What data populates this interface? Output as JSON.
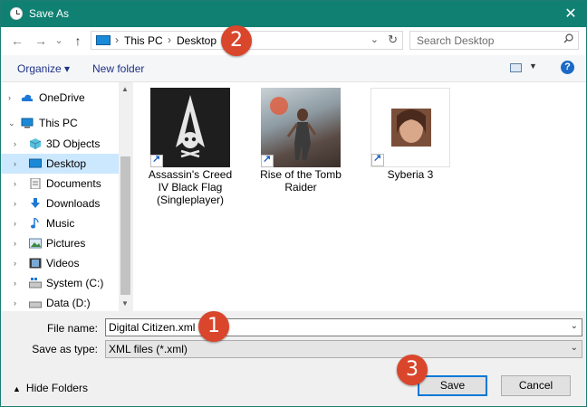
{
  "window": {
    "title": "Save As",
    "close_glyph": "✕",
    "accent_color": "#108072"
  },
  "nav": {
    "back_glyph": "←",
    "forward_glyph": "→",
    "recent_glyph": "⌄",
    "up_glyph": "↑",
    "address": [
      "This PC",
      "Desktop"
    ],
    "address_sep": "›",
    "address_dropdown_glyph": "⌄",
    "refresh_glyph": "↻",
    "search_placeholder": "Search Desktop"
  },
  "toolbar": {
    "organize_label": "Organize ▾",
    "new_folder_label": "New folder",
    "view_dropdown_glyph": "▼",
    "help_label": "?"
  },
  "sidebar": {
    "items": [
      {
        "label": "OneDrive",
        "icon": "cloud-icon",
        "expander": "›",
        "selected": false
      },
      {
        "label": "This PC",
        "icon": "computer-icon",
        "expander": "⌄",
        "selected": false
      },
      {
        "label": "3D Objects",
        "icon": "cube-icon",
        "expander": "›",
        "selected": false
      },
      {
        "label": "Desktop",
        "icon": "desktop-icon",
        "expander": "›",
        "selected": true
      },
      {
        "label": "Documents",
        "icon": "documents-icon",
        "expander": "›",
        "selected": false
      },
      {
        "label": "Downloads",
        "icon": "download-icon",
        "expander": "›",
        "selected": false
      },
      {
        "label": "Music",
        "icon": "music-icon",
        "expander": "›",
        "selected": false
      },
      {
        "label": "Pictures",
        "icon": "pictures-icon",
        "expander": "›",
        "selected": false
      },
      {
        "label": "Videos",
        "icon": "videos-icon",
        "expander": "›",
        "selected": false
      },
      {
        "label": "System (C:)",
        "icon": "drive-icon",
        "expander": "›",
        "selected": false
      },
      {
        "label": "Data (D:)",
        "icon": "drive-icon",
        "expander": "›",
        "selected": false
      }
    ],
    "scroll_up_glyph": "▲",
    "scroll_down_glyph": "▼"
  },
  "files": [
    {
      "name": "Assassin's Creed IV Black Flag (Singleplayer)",
      "lines": [
        "Assassin's Creed",
        "IV Black Flag",
        "(Singleplayer)"
      ],
      "icon": "assassins-creed-icon"
    },
    {
      "name": "Rise of the Tomb Raider",
      "lines": [
        "Rise of the Tomb",
        "Raider"
      ],
      "icon": "tomb-raider-icon"
    },
    {
      "name": "Syberia 3",
      "lines": [
        "Syberia 3"
      ],
      "icon": "syberia-icon"
    }
  ],
  "form": {
    "file_name_label": "File name:",
    "file_name_value": "Digital Citizen.xml",
    "save_type_label": "Save as type:",
    "save_type_value": "XML files (*.xml)",
    "dropdown_glyph": "⌄"
  },
  "footer": {
    "hide_folders_arrow": "▲",
    "hide_folders_label": "Hide Folders",
    "save_label": "Save",
    "cancel_label": "Cancel"
  },
  "badges": {
    "one": "1",
    "two": "2",
    "three": "3",
    "color": "#d9462c"
  }
}
